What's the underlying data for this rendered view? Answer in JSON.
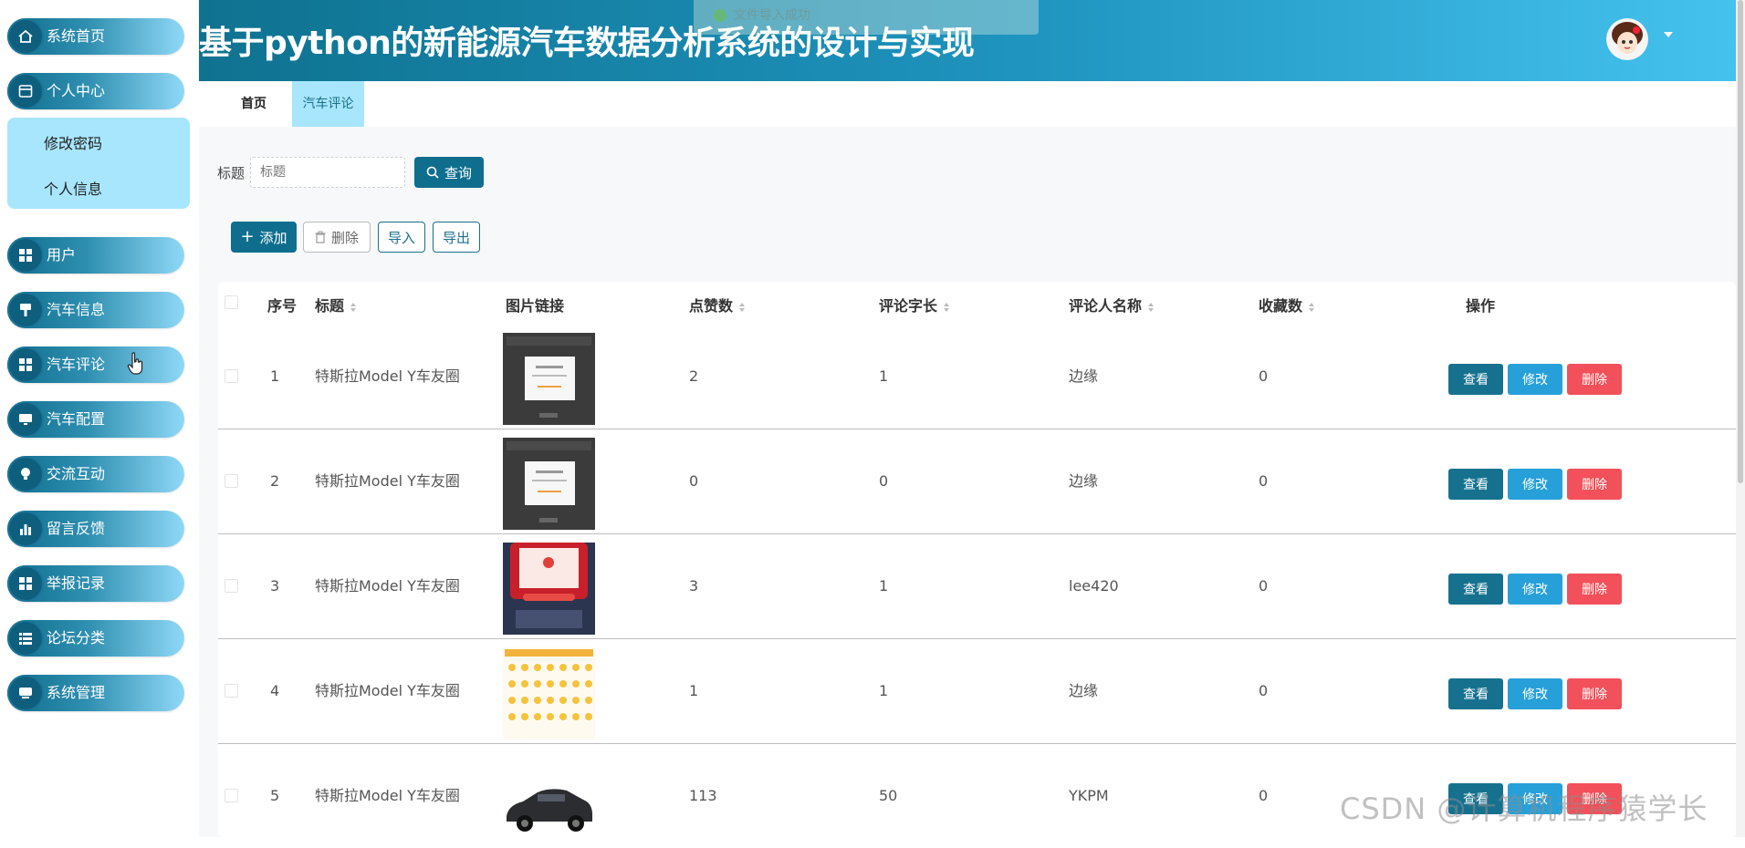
{
  "app": {
    "title": "基于python的新能源汽车数据分析系统的设计与实现",
    "toast": "文件导入成功"
  },
  "sidebar": {
    "items": [
      {
        "label": "系统首页",
        "icon": "home-icon"
      },
      {
        "label": "个人中心",
        "icon": "profile-card-icon"
      },
      {
        "label": "用户",
        "icon": "grid-icon"
      },
      {
        "label": "汽车信息",
        "icon": "brush-icon"
      },
      {
        "label": "汽车评论",
        "icon": "grid-icon"
      },
      {
        "label": "汽车配置",
        "icon": "monitor-icon"
      },
      {
        "label": "交流互动",
        "icon": "bulb-icon"
      },
      {
        "label": "留言反馈",
        "icon": "bar-chart-icon"
      },
      {
        "label": "举报记录",
        "icon": "grid-icon"
      },
      {
        "label": "论坛分类",
        "icon": "list-icon"
      },
      {
        "label": "系统管理",
        "icon": "chat-icon"
      }
    ],
    "submenu": [
      "修改密码",
      "个人信息"
    ]
  },
  "tabs": [
    {
      "label": "首页",
      "active": false
    },
    {
      "label": "汽车评论",
      "active": true
    }
  ],
  "search": {
    "label": "标题",
    "placeholder": "标题",
    "button": "查询"
  },
  "toolbar": {
    "add": "添加",
    "delete": "删除",
    "import": "导入",
    "export": "导出"
  },
  "table": {
    "headers": {
      "index": "序号",
      "title": "标题",
      "image": "图片链接",
      "likes": "点赞数",
      "length": "评论字长",
      "author": "评论人名称",
      "favorites": "收藏数",
      "actions": "操作"
    },
    "action_labels": {
      "view": "查看",
      "edit": "修改",
      "delete": "删除"
    },
    "rows": [
      {
        "index": "1",
        "title": "特斯拉Model Y车友圈",
        "likes": "2",
        "length": "1",
        "author": "边缘",
        "favorites": "0",
        "image": "dark-dialog"
      },
      {
        "index": "2",
        "title": "特斯拉Model Y车友圈",
        "likes": "0",
        "length": "0",
        "author": "边缘",
        "favorites": "0",
        "image": "dark-dialog"
      },
      {
        "index": "3",
        "title": "特斯拉Model Y车友圈",
        "likes": "3",
        "length": "1",
        "author": "lee420",
        "favorites": "0",
        "image": "red-poster"
      },
      {
        "index": "4",
        "title": "特斯拉Model Y车友圈",
        "likes": "1",
        "length": "1",
        "author": "边缘",
        "favorites": "0",
        "image": "emoji-grid"
      },
      {
        "index": "5",
        "title": "特斯拉Model Y车友圈",
        "likes": "113",
        "length": "50",
        "author": "YKPM",
        "favorites": "0",
        "image": "car-photo"
      }
    ]
  },
  "watermark": "CSDN @计算机程序猿学长",
  "colors": {
    "primary": "#0f6e8e",
    "edit": "#27a0d9",
    "danger": "#f2505a",
    "submenu_bg": "#a7e6fc"
  }
}
